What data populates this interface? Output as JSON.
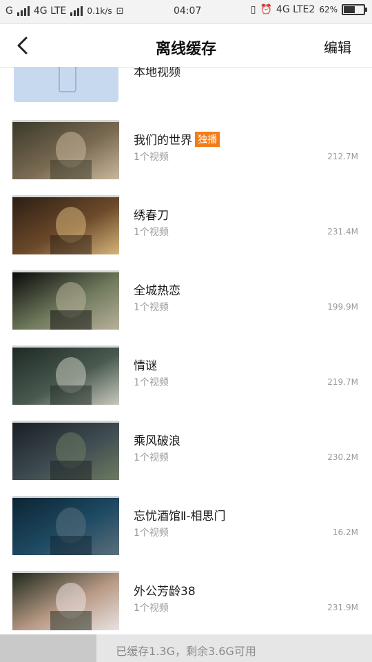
{
  "status_bar": {
    "carrier_left": "G",
    "network_left": "4G LTE",
    "speed": "0.1k/s",
    "time": "04:07",
    "network_right": "4G LTE2",
    "battery": "62",
    "battery_level": 0.62
  },
  "header": {
    "title": "离线缓存",
    "edit_label": "编辑",
    "back_icon": "chevron-left-icon"
  },
  "local": {
    "title": "本地视频",
    "icon": "phone-icon"
  },
  "items": [
    {
      "title": "我们的世界",
      "badge": "独播",
      "sub": "1个视频",
      "size": "212.7M",
      "colors": [
        "#3a3a2a",
        "#7a6a52",
        "#c9b79c"
      ]
    },
    {
      "title": "绣春刀",
      "badge": "",
      "sub": "1个视频",
      "size": "231.4M",
      "colors": [
        "#2c1e14",
        "#6d4a2a",
        "#d6b47a"
      ]
    },
    {
      "title": "全城热恋",
      "badge": "",
      "sub": "1个视频",
      "size": "199.9M",
      "colors": [
        "#0a0a0a",
        "#6f7a5c",
        "#b8b09a"
      ]
    },
    {
      "title": "情谜",
      "badge": "",
      "sub": "1个视频",
      "size": "219.7M",
      "colors": [
        "#1d2a24",
        "#4a5a50",
        "#c9c9bd"
      ]
    },
    {
      "title": "乘风破浪",
      "badge": "",
      "sub": "1个视频",
      "size": "230.2M",
      "colors": [
        "#1a1f24",
        "#3f4c52",
        "#6d7a60"
      ]
    },
    {
      "title": "忘忧酒馆Ⅱ-相思门",
      "badge": "",
      "sub": "1个视频",
      "size": "16.2M",
      "colors": [
        "#0d2433",
        "#1e4a63",
        "#5a6f7a"
      ]
    },
    {
      "title": "外公芳龄38",
      "badge": "",
      "sub": "1个视频",
      "size": "231.9M",
      "colors": [
        "#1f2a1c",
        "#b99a86",
        "#e9e2e2"
      ]
    }
  ],
  "footer": {
    "storage_text": "已缓存1.3G，剩余3.6G可用",
    "used_fraction": 0.26
  }
}
